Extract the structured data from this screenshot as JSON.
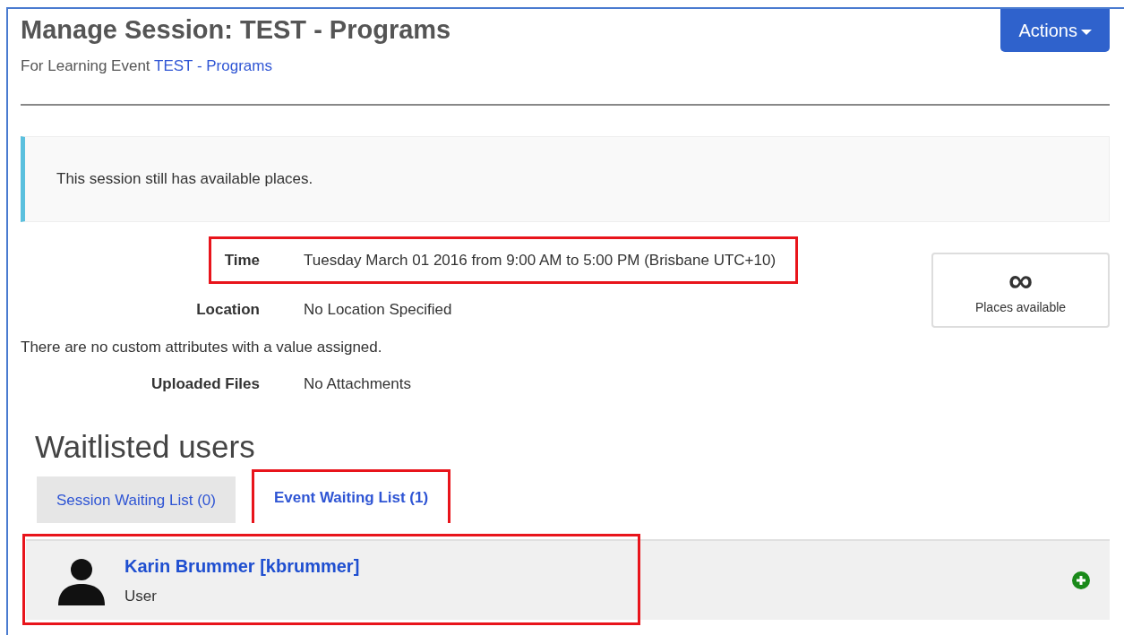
{
  "header": {
    "title": "Manage Session: TEST - Programs",
    "subtitle_prefix": "For Learning Event",
    "event_link": "TEST - Programs",
    "actions_button": "Actions"
  },
  "alert": {
    "text": "This session still has available places."
  },
  "details": [
    {
      "kind": "row",
      "label": "Time",
      "value": "Tuesday March 01 2016 from 9:00 AM to 5:00 PM (Brisbane UTC+10)",
      "highlighted": true
    },
    {
      "kind": "row",
      "label": "Location",
      "value": "No Location Specified",
      "highlighted": false
    },
    {
      "kind": "note",
      "text": "There are no custom attributes with a value assigned."
    },
    {
      "kind": "row",
      "label": "Uploaded Files",
      "value": "No Attachments",
      "highlighted": false
    }
  ],
  "places": {
    "symbol": "∞",
    "label": "Places available"
  },
  "waitlist": {
    "heading": "Waitlisted users",
    "tabs": [
      {
        "label": "Session Waiting List (0)",
        "selected": false,
        "highlighted": false
      },
      {
        "label": "Event Waiting List (1)",
        "selected": true,
        "highlighted": true
      }
    ],
    "users": [
      {
        "name": "Karin Brummer [kbrummer]",
        "role": "User",
        "highlighted": true
      }
    ]
  }
}
